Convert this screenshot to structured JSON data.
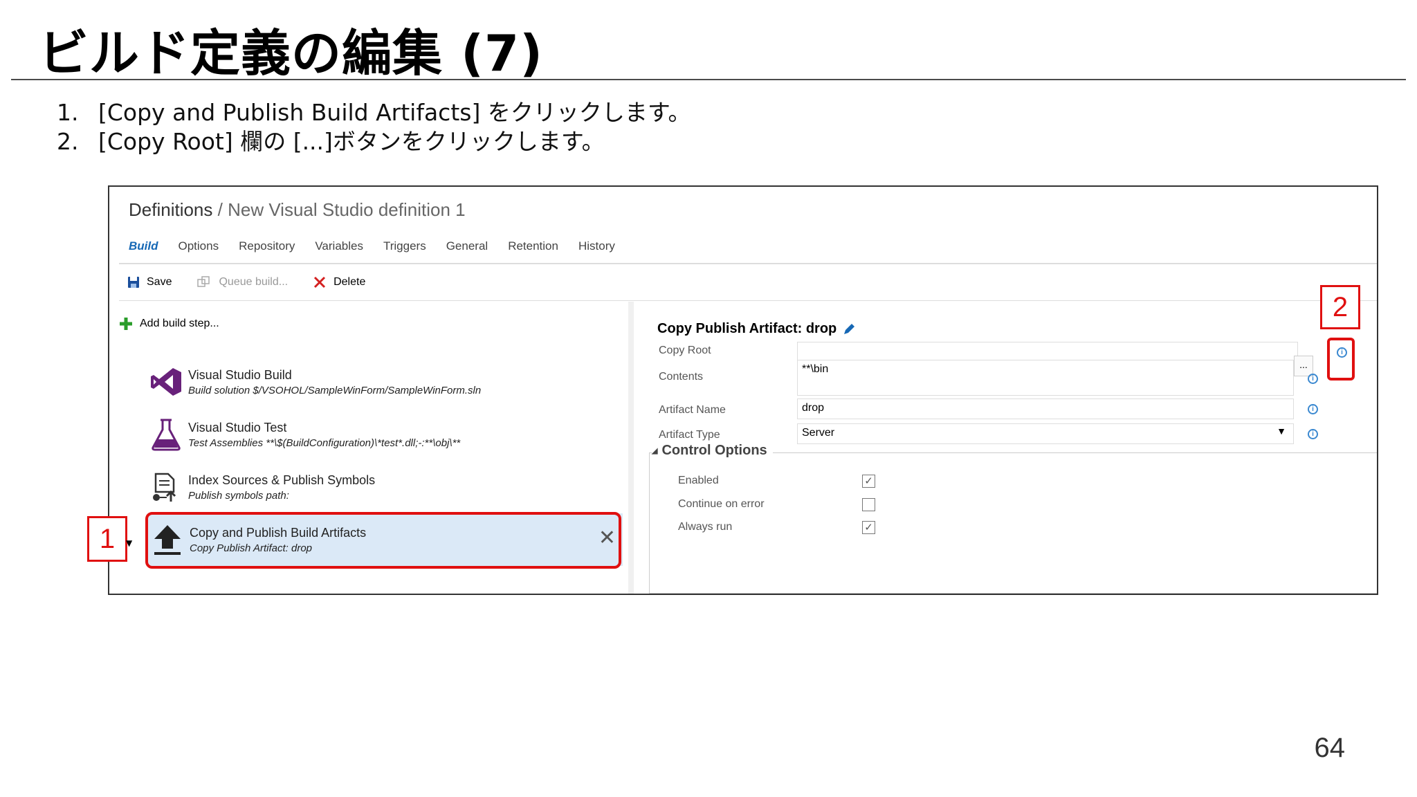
{
  "slide": {
    "title": "ビルド定義の編集 (7)",
    "steps": [
      {
        "num": "1.",
        "text": "[Copy and Publish Build Artifacts] をクリックします。"
      },
      {
        "num": "2.",
        "text": "[Copy Root] 欄の [...]ボタンをクリックします。"
      }
    ],
    "page_number": "64"
  },
  "app": {
    "breadcrumb": {
      "root": "Definitions",
      "sep": " / ",
      "current": "New Visual Studio definition 1"
    },
    "tabs": [
      {
        "label": "Build",
        "active": true
      },
      {
        "label": "Options"
      },
      {
        "label": "Repository"
      },
      {
        "label": "Variables"
      },
      {
        "label": "Triggers"
      },
      {
        "label": "General"
      },
      {
        "label": "Retention"
      },
      {
        "label": "History"
      }
    ],
    "toolbar": {
      "save": "Save",
      "queue": "Queue build...",
      "delete": "Delete"
    },
    "add_step": "Add build step...",
    "build_steps": [
      {
        "title": "Visual Studio Build",
        "subtitle": "Build solution $/VSOHOL/SampleWinForm/SampleWinForm.sln",
        "icon": "visual-studio-icon"
      },
      {
        "title": "Visual Studio Test",
        "subtitle": "Test Assemblies **\\$(BuildConfiguration)\\*test*.dll;-:**\\obj\\**",
        "icon": "flask-icon"
      },
      {
        "title": "Index Sources & Publish Symbols",
        "subtitle": "Publish symbols path:",
        "icon": "symbols-icon"
      },
      {
        "title": "Copy and Publish Build Artifacts",
        "subtitle": "Copy Publish Artifact: drop",
        "icon": "upload-icon",
        "selected": true
      }
    ],
    "detail": {
      "title": "Copy Publish Artifact: drop",
      "fields": {
        "copy_root": {
          "label": "Copy Root",
          "value": ""
        },
        "contents": {
          "label": "Contents",
          "value": "**\\bin"
        },
        "artifact_name": {
          "label": "Artifact Name",
          "value": "drop"
        },
        "artifact_type": {
          "label": "Artifact Type",
          "value": "Server"
        }
      },
      "browse_label": "...",
      "control_options": {
        "header": "Control Options",
        "enabled": {
          "label": "Enabled",
          "checked": true
        },
        "continue_on_error": {
          "label": "Continue on error",
          "checked": false
        },
        "always_run": {
          "label": "Always run",
          "checked": true
        }
      }
    }
  },
  "callouts": [
    "1",
    "2"
  ],
  "colors": {
    "highlight": "#e01010",
    "accent": "#1668b5",
    "selected_bg": "#dbe9f7"
  }
}
